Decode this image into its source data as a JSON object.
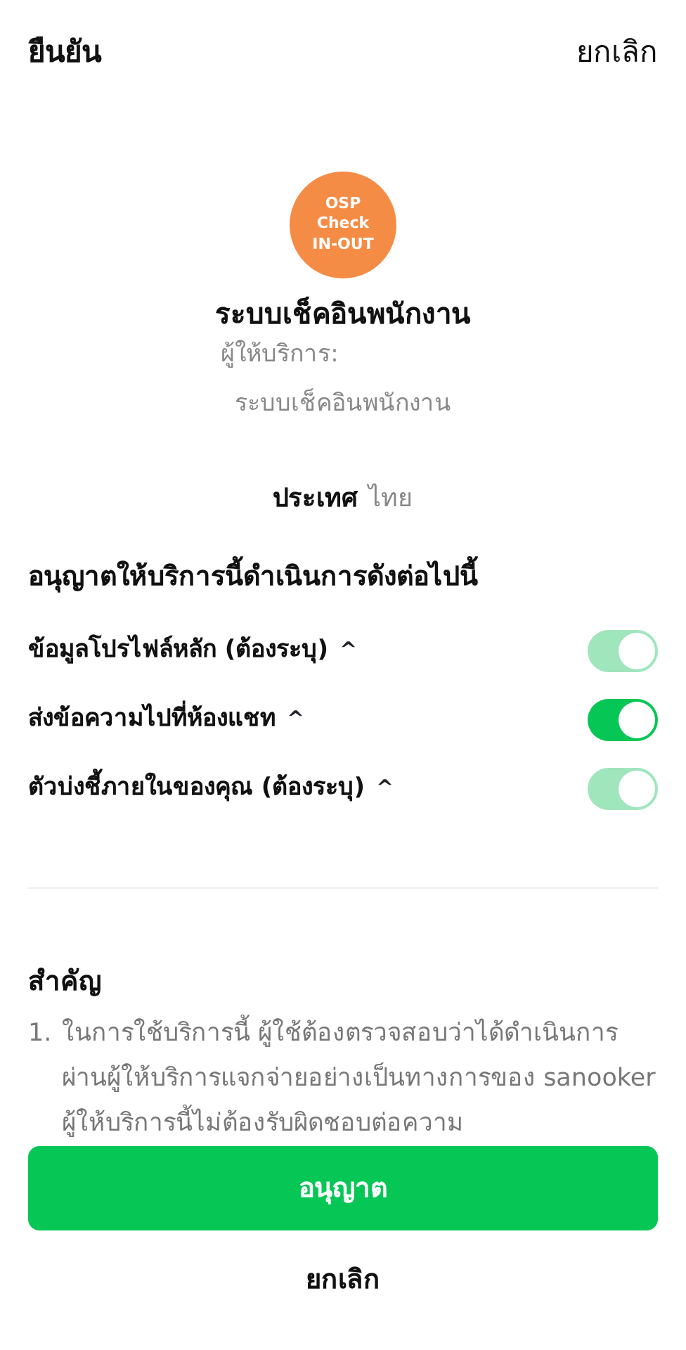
{
  "header": {
    "confirm": "ยืนยัน",
    "cancel": "ยกเลิก"
  },
  "app": {
    "logo_lines": [
      "OSP",
      "Check",
      "IN-OUT"
    ],
    "name": "ระบบเช็คอินพนักงาน",
    "provider_label": "ผู้ให้บริการ:",
    "provider_name": "ระบบเช็คอินพนักงาน"
  },
  "country": {
    "label": "ประเทศ",
    "value": "ไทย"
  },
  "permissions": {
    "heading": "อนุญาตให้บริการนี้ดำเนินการดังต่อไปนี้",
    "caret": "^",
    "items": [
      {
        "label": "ข้อมูลโปรไฟล์หลัก (ต้องระบุ)",
        "on": true,
        "disabled": true
      },
      {
        "label": "ส่งข้อความไปที่ห้องแชท",
        "on": true,
        "disabled": false
      },
      {
        "label": "ตัวบ่งชี้ภายในของคุณ (ต้องระบุ)",
        "on": true,
        "disabled": true
      }
    ]
  },
  "important": {
    "heading": "สำคัญ",
    "items": [
      {
        "number": "1.",
        "text": "ในการใช้บริการนี้ ผู้ใช้ต้องตรวจสอบว่าได้ดำเนินการผ่านผู้ให้บริการแจกจ่ายอย่างเป็นทางการของ sanooker ผู้ให้บริการนี้ไม่ต้องรับผิดชอบต่อความ"
      }
    ]
  },
  "buttons": {
    "allow": "อนุญาต",
    "cancel": "ยกเลิก"
  }
}
